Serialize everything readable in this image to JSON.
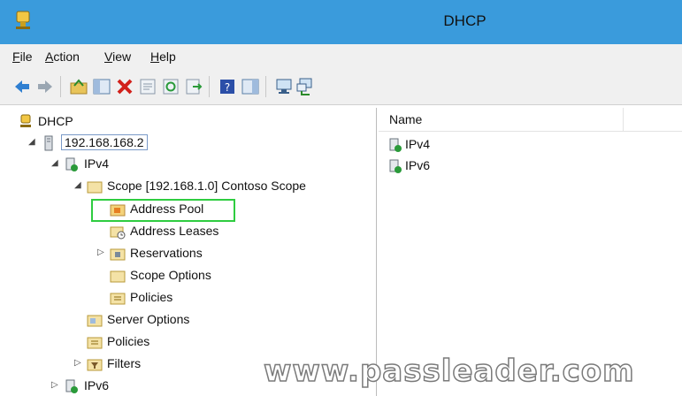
{
  "window": {
    "title": "DHCP"
  },
  "menu": [
    {
      "label": "File"
    },
    {
      "label": "Action"
    },
    {
      "label": "View"
    },
    {
      "label": "Help"
    }
  ],
  "toolbar": [
    "back-icon",
    "forward-icon",
    "up-folder-icon",
    "show-hide-tree-icon",
    "delete-icon",
    "properties-icon",
    "refresh-icon",
    "export-list-icon",
    "help-icon",
    "show-hide-action-pane-icon",
    "server-icon",
    "network-icon"
  ],
  "tree": {
    "root": "DHCP",
    "server": "192.168.168.2",
    "ipv4": "IPv4",
    "scope": "Scope [192.168.1.0] Contoso Scope",
    "address_pool": "Address Pool",
    "address_leases": "Address Leases",
    "reservations": "Reservations",
    "scope_options": "Scope Options",
    "scope_policies": "Policies",
    "server_options": "Server Options",
    "policies": "Policies",
    "filters": "Filters",
    "ipv6": "IPv6"
  },
  "list": {
    "column_name": "Name",
    "items": [
      "IPv4",
      "IPv6"
    ]
  },
  "watermark": "www.passleader.com",
  "colors": {
    "titlebar": "#3a9bdc",
    "highlight": "#2ecc40"
  }
}
